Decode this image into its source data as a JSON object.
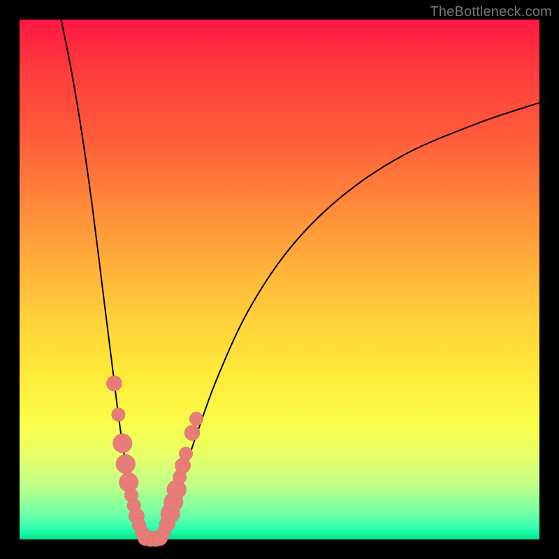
{
  "watermark": "TheBottleneck.com",
  "chart_data": {
    "type": "line",
    "title": "",
    "xlabel": "",
    "ylabel": "",
    "xlim": [
      0,
      100
    ],
    "ylim": [
      0,
      100
    ],
    "curve_left": {
      "name": "left-branch",
      "x": [
        8,
        10,
        12,
        14,
        16,
        18,
        19,
        20,
        21,
        22,
        23,
        23.5,
        24
      ],
      "y": [
        100,
        90,
        78,
        64,
        48,
        32,
        24,
        17,
        11,
        6,
        2.5,
        1,
        0
      ]
    },
    "curve_right": {
      "name": "right-branch",
      "x": [
        27,
        28,
        29,
        30,
        32,
        34,
        38,
        44,
        52,
        62,
        74,
        88,
        100
      ],
      "y": [
        0,
        1.5,
        4,
        7,
        14,
        20,
        31,
        44,
        56,
        66,
        74,
        80,
        84
      ]
    },
    "beads_left": {
      "name": "left-markers",
      "points": [
        {
          "x": 18.2,
          "y": 30,
          "r": 1.2
        },
        {
          "x": 19.0,
          "y": 24,
          "r": 1.0
        },
        {
          "x": 19.8,
          "y": 18.5,
          "r": 1.6
        },
        {
          "x": 20.4,
          "y": 14.5,
          "r": 1.6
        },
        {
          "x": 21.0,
          "y": 11,
          "r": 1.6
        },
        {
          "x": 21.5,
          "y": 8.5,
          "r": 1.0
        },
        {
          "x": 22.0,
          "y": 6.5,
          "r": 1.0
        },
        {
          "x": 22.5,
          "y": 4.5,
          "r": 1.2
        },
        {
          "x": 23.0,
          "y": 2.8,
          "r": 1.0
        },
        {
          "x": 23.5,
          "y": 1.5,
          "r": 1.0
        }
      ]
    },
    "beads_bottom": {
      "name": "bottom-markers",
      "points": [
        {
          "x": 24.2,
          "y": 0.3,
          "r": 1.2
        },
        {
          "x": 25.2,
          "y": 0.1,
          "r": 1.2
        },
        {
          "x": 26.2,
          "y": 0.1,
          "r": 1.2
        },
        {
          "x": 27.0,
          "y": 0.3,
          "r": 1.2
        }
      ]
    },
    "beads_right": {
      "name": "right-markers",
      "points": [
        {
          "x": 27.8,
          "y": 1.5,
          "r": 1.0
        },
        {
          "x": 28.4,
          "y": 3.0,
          "r": 1.2
        },
        {
          "x": 29.0,
          "y": 5.0,
          "r": 1.6
        },
        {
          "x": 29.6,
          "y": 7.2,
          "r": 1.6
        },
        {
          "x": 30.2,
          "y": 9.6,
          "r": 1.6
        },
        {
          "x": 30.8,
          "y": 12.0,
          "r": 1.0
        },
        {
          "x": 31.4,
          "y": 14.2,
          "r": 1.2
        },
        {
          "x": 32.0,
          "y": 16.5,
          "r": 1.0
        },
        {
          "x": 33.2,
          "y": 20.5,
          "r": 1.2
        },
        {
          "x": 34.0,
          "y": 23.2,
          "r": 1.0
        }
      ]
    }
  }
}
